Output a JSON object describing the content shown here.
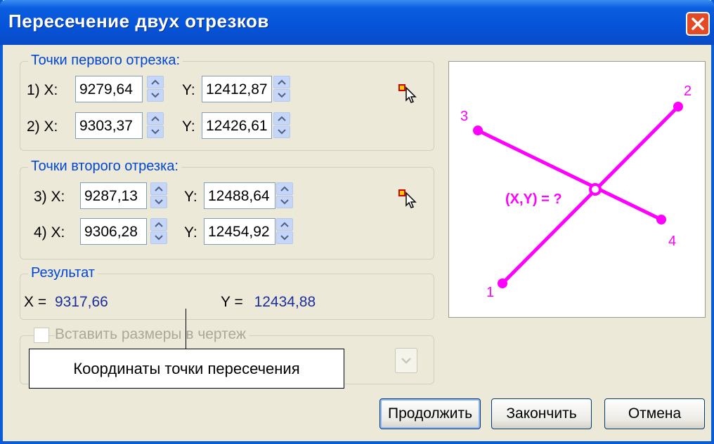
{
  "window": {
    "title": "Пересечение двух отрезков"
  },
  "segment1": {
    "legend": "Точки первого отрезка:",
    "points": [
      {
        "label": "1) X:",
        "x": "9279,64",
        "ylabel": "Y:",
        "y": "12412,87"
      },
      {
        "label": "2) X:",
        "x": "9303,37",
        "ylabel": "Y:",
        "y": "12426,61"
      }
    ]
  },
  "segment2": {
    "legend": "Точки второго отрезка:",
    "points": [
      {
        "label": "3) X:",
        "x": "9287,13",
        "ylabel": "Y:",
        "y": "12488,64"
      },
      {
        "label": "4) X:",
        "x": "9306,28",
        "ylabel": "Y:",
        "y": "12454,92"
      }
    ]
  },
  "result": {
    "legend": "Результат",
    "x_label": "X =",
    "x_value": "9317,66",
    "y_label": "Y =",
    "y_value": "12434,88"
  },
  "insert": {
    "label": "Вставить размеры в чертеж",
    "checked": false,
    "enabled": false
  },
  "diagram": {
    "labels": {
      "p1": "1",
      "p2": "2",
      "p3": "3",
      "p4": "4",
      "intersection": "(X,Y) = ?"
    },
    "color": "#ff00ff"
  },
  "buttons": {
    "continue": "Продолжить",
    "finish": "Закончить",
    "cancel": "Отмена"
  },
  "callout": {
    "text": "Координаты точки пересечения"
  },
  "icons": {
    "pick": "pick-point-icon",
    "close": "close-icon",
    "spin": "spin-arrows-icon"
  }
}
